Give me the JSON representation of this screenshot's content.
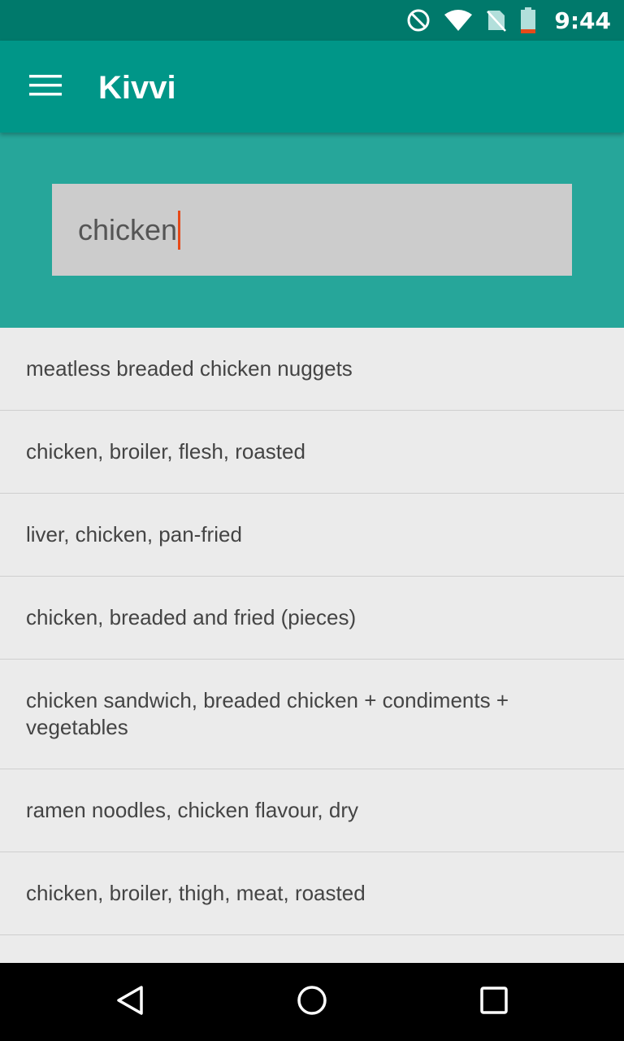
{
  "status_bar": {
    "time": "9:44",
    "icons": [
      "do-not-disturb-icon",
      "wifi-icon",
      "no-sim-icon",
      "battery-low-icon"
    ],
    "colors": {
      "background": "#00796b",
      "battery_low": "#e64a19"
    }
  },
  "app_bar": {
    "title": "Kivvi",
    "menu_icon": "hamburger-menu-icon",
    "colors": {
      "background": "#009688"
    }
  },
  "search": {
    "value": "chicken",
    "colors": {
      "panel": "#26a69a",
      "box": "#cccccc",
      "cursor": "#e64a19"
    }
  },
  "results": [
    {
      "label": "meatless breaded chicken nuggets"
    },
    {
      "label": "chicken, broiler, flesh, roasted"
    },
    {
      "label": "liver, chicken, pan-fried"
    },
    {
      "label": "chicken, breaded and fried (pieces)"
    },
    {
      "label": "chicken sandwich, breaded chicken + condiments + vegetables"
    },
    {
      "label": "ramen noodles, chicken flavour, dry"
    },
    {
      "label": "chicken, broiler, thigh, meat, roasted"
    },
    {
      "label": ""
    }
  ],
  "nav_bar": {
    "buttons": [
      "back-icon",
      "home-icon",
      "recents-icon"
    ]
  }
}
